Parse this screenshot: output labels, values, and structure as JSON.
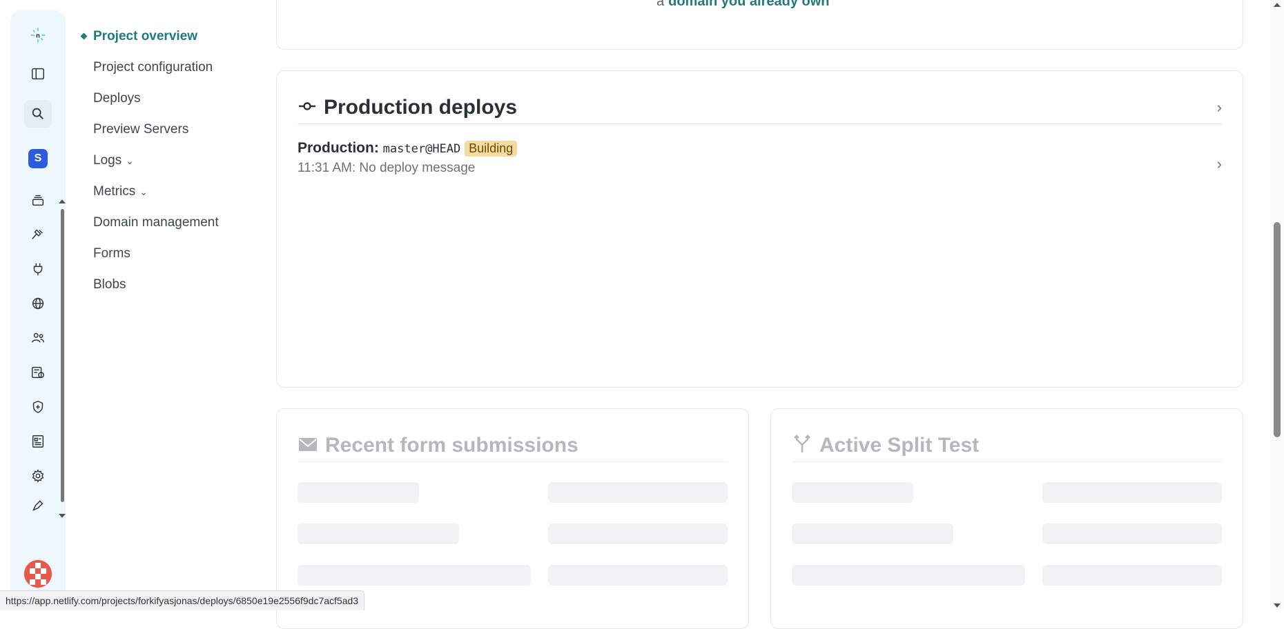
{
  "rail": {
    "logo": "netlify-logo-icon",
    "team_initial": "S",
    "icons": [
      "sidebar-toggle-icon",
      "search-icon",
      "team-badge",
      "layers-icon",
      "hammer-icon",
      "plug-icon",
      "globe-icon",
      "users-icon",
      "billing-icon",
      "shield-icon",
      "docs-icon",
      "gear-icon",
      "pen-icon"
    ]
  },
  "nav": {
    "items": [
      {
        "label": "Project overview",
        "active": true
      },
      {
        "label": "Project configuration"
      },
      {
        "label": "Deploys"
      },
      {
        "label": "Preview Servers"
      },
      {
        "label": "Logs",
        "chevron": "⌄"
      },
      {
        "label": "Metrics",
        "chevron": "⌄"
      },
      {
        "label": "Domain management"
      },
      {
        "label": "Forms"
      },
      {
        "label": "Blobs"
      }
    ]
  },
  "top_card": {
    "prefix": "a",
    "link": "domain you already own"
  },
  "production": {
    "title": "Production deploys",
    "deploy": {
      "label": "Production:",
      "ref": "master@HEAD",
      "status": "Building",
      "time_message": "11:31 AM: No deploy message"
    },
    "arrow": "›"
  },
  "forms": {
    "title": "Recent form submissions"
  },
  "split": {
    "title": "Active Split Test"
  },
  "status_bar": {
    "url": "https://app.netlify.com/projects/forkifyasjonas/deploys/6850e19e2556f9dc7acf5ad3"
  }
}
